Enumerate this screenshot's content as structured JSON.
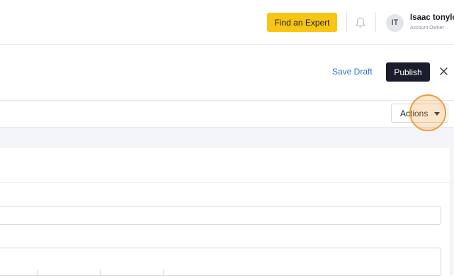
{
  "topbar": {
    "find_expert_label": "Find an Expert",
    "bell_icon": "bell-icon",
    "avatar_initials": "IT",
    "user_name": "Isaac tonylo",
    "user_role": "Account Owner"
  },
  "editor_header": {
    "save_draft_label": "Save Draft",
    "publish_label": "Publish",
    "close_icon": "close-icon"
  },
  "toolbar": {
    "actions_label": "Actions",
    "actions_icon": "caret-down-icon"
  },
  "colors": {
    "accent_yellow": "#f8c512",
    "publish_dark": "#1a1d2b",
    "link_blue": "#2f74d0",
    "click_highlight": "#f39a3b"
  }
}
